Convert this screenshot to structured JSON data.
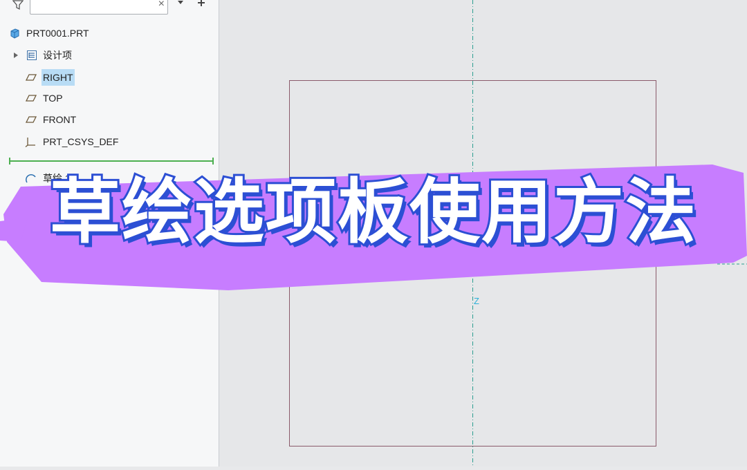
{
  "model_tree": {
    "search": {
      "value": "",
      "clear_glyph": "×"
    },
    "items": [
      {
        "label": "PRT0001.PRT",
        "icon": "part-icon"
      },
      {
        "label": "设计项",
        "icon": "design-items-icon",
        "expandable": true
      },
      {
        "label": "RIGHT",
        "icon": "datum-plane-icon",
        "selected": true
      },
      {
        "label": "TOP",
        "icon": "datum-plane-icon"
      },
      {
        "label": "FRONT",
        "icon": "datum-plane-icon"
      },
      {
        "label": "PRT_CSYS_DEF",
        "icon": "coordinate-system-icon"
      },
      {
        "label": "草绘 1",
        "icon": "sketch-icon"
      }
    ]
  },
  "graphics": {
    "axis_label": "Z"
  },
  "overlay": {
    "title": "草绘选项板使用方法",
    "highlight_color": "#c77dff",
    "text_outline_color": "#2c4fd4",
    "text_fill_color": "#ffffff"
  },
  "colors": {
    "datum_line": "#2a9d8f",
    "sketch_frame": "#8a5a6a",
    "selection": "#b8dcf5",
    "insert_line": "#4caf50"
  }
}
